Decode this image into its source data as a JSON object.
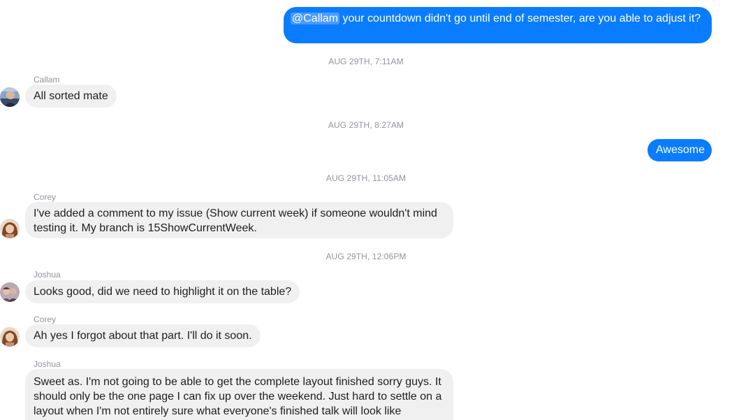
{
  "messages": {
    "m1": {
      "mention": "@Callam",
      "text": " your countdown didn't go until end of semester, are you able to adjust it?"
    },
    "ts1": "AUG 29TH, 7:11AM",
    "m2": {
      "sender": "Callam",
      "text": "All sorted mate"
    },
    "ts2": "AUG 29TH, 8:27AM",
    "m3": {
      "text": "Awesome"
    },
    "ts3": "AUG 29TH, 11:05AM",
    "m4": {
      "sender": "Corey",
      "text": "I've added a comment to my issue (Show current week) if someone wouldn't mind testing it. My branch is 15ShowCurrentWeek."
    },
    "ts4": "AUG 29TH, 12:06PM",
    "m5": {
      "sender": "Joshua",
      "text": "Looks good, did we need to highlight it on the table?"
    },
    "m6": {
      "sender": "Corey",
      "text": "Ah yes I forgot about that part. I'll do it soon."
    },
    "m7": {
      "sender": "Joshua",
      "text": "Sweet as. I'm not going to be able to get the complete layout finished sorry guys. It should only be the one page I can fix up over the weekend. Just hard to settle on a layout when I'm not entirely sure what everyone's finished talk will look like"
    }
  },
  "colors": {
    "outgoing_bubble": "#0a7cff",
    "incoming_bubble": "#f1f0f0",
    "meta_text": "#90949c"
  },
  "icons": {
    "avatar_callam": "avatar-photo",
    "avatar_corey": "avatar-photo",
    "avatar_joshua": "avatar-photo"
  }
}
